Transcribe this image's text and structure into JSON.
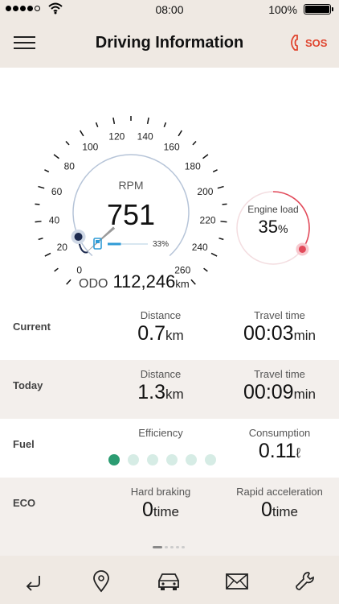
{
  "status_bar": {
    "time": "08:00",
    "battery": "100%"
  },
  "header": {
    "title": "Driving Information",
    "sos_label": "SOS"
  },
  "gauge": {
    "speed_ticks": [
      "0",
      "20",
      "40",
      "60",
      "80",
      "100",
      "120",
      "140",
      "160",
      "180",
      "200",
      "220",
      "240",
      "260"
    ],
    "speed_value": 6,
    "rpm_label": "RPM",
    "rpm_value": "751",
    "fuel_level": 0.33,
    "fuel_percent": "33%",
    "engine_load_label": "Engine load",
    "engine_load_value": "35",
    "engine_load_unit": "%",
    "engine_load_fraction": 0.35,
    "odo_label": "ODO",
    "odo_value": "112,246",
    "odo_unit": "km"
  },
  "stats": {
    "current": {
      "label": "Current",
      "distance_label": "Distance",
      "distance_value": "0.7",
      "distance_unit": "km",
      "travel_label": "Travel time",
      "travel_value": "00:03",
      "travel_unit": "min"
    },
    "today": {
      "label": "Today",
      "distance_label": "Distance",
      "distance_value": "1.3",
      "distance_unit": "km",
      "travel_label": "Travel time",
      "travel_value": "00:09",
      "travel_unit": "min"
    },
    "fuel": {
      "label": "Fuel",
      "efficiency_label": "Efficiency",
      "efficiency_level": 1,
      "efficiency_max": 6,
      "consumption_label": "Consumption",
      "consumption_value": "0.11",
      "consumption_unit": "ℓ"
    },
    "eco": {
      "label": "ECO",
      "braking_label": "Hard braking",
      "braking_value": "0",
      "braking_unit": "time",
      "accel_label": "Rapid acceleration",
      "accel_value": "0",
      "accel_unit": "time"
    }
  },
  "pager": {
    "current": 1,
    "total": 5
  },
  "tabs": [
    {
      "icon": "back-arrow-icon"
    },
    {
      "icon": "location-pin-icon"
    },
    {
      "icon": "car-icon"
    },
    {
      "icon": "mail-icon"
    },
    {
      "icon": "wrench-icon"
    }
  ],
  "colors": {
    "accent_red": "#e0452f",
    "eco_green": "#2c9c72",
    "fuel_blue": "#2f9bd6",
    "gauge_navy": "#1d2a4f",
    "load_red": "#e24a5a"
  }
}
